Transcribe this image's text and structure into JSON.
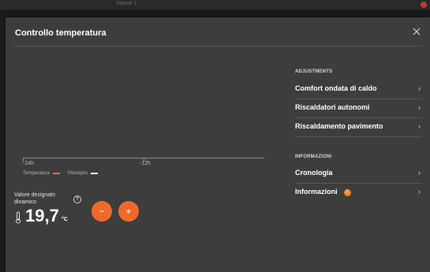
{
  "background": {
    "window_title": "Hasse 1"
  },
  "dialog": {
    "title": "Controllo temperatura",
    "close_icon": "close-icon"
  },
  "chart_data": {
    "type": "line",
    "x_tick_labels": [
      "-24h",
      "-12h"
    ],
    "series": [
      {
        "name": "Temperatura",
        "color": "#ee6a2b",
        "values": []
      },
      {
        "name": "Percepito",
        "color": "#ffffff",
        "values": []
      }
    ]
  },
  "setpoint": {
    "label": "Valore designato dinamico",
    "help_icon": "?",
    "value": "19,7",
    "unit": "°C",
    "minus_label": "−",
    "plus_label": "+"
  },
  "adjustments": {
    "header": "ADJUSTMENTS",
    "items": [
      {
        "label": "Comfort ondata di caldo"
      },
      {
        "label": "Riscaldatori autonomi"
      },
      {
        "label": "Riscaldamento pavimento"
      }
    ]
  },
  "informazioni": {
    "header": "INFORMAZIONI",
    "items": [
      {
        "label": "Cronologia"
      },
      {
        "label": "Informazioni",
        "badge": "!"
      }
    ]
  },
  "chevron": "›",
  "colors": {
    "accent": "#ee6a2b",
    "badge": "#f08a24",
    "panel": "#3d3d3d"
  }
}
